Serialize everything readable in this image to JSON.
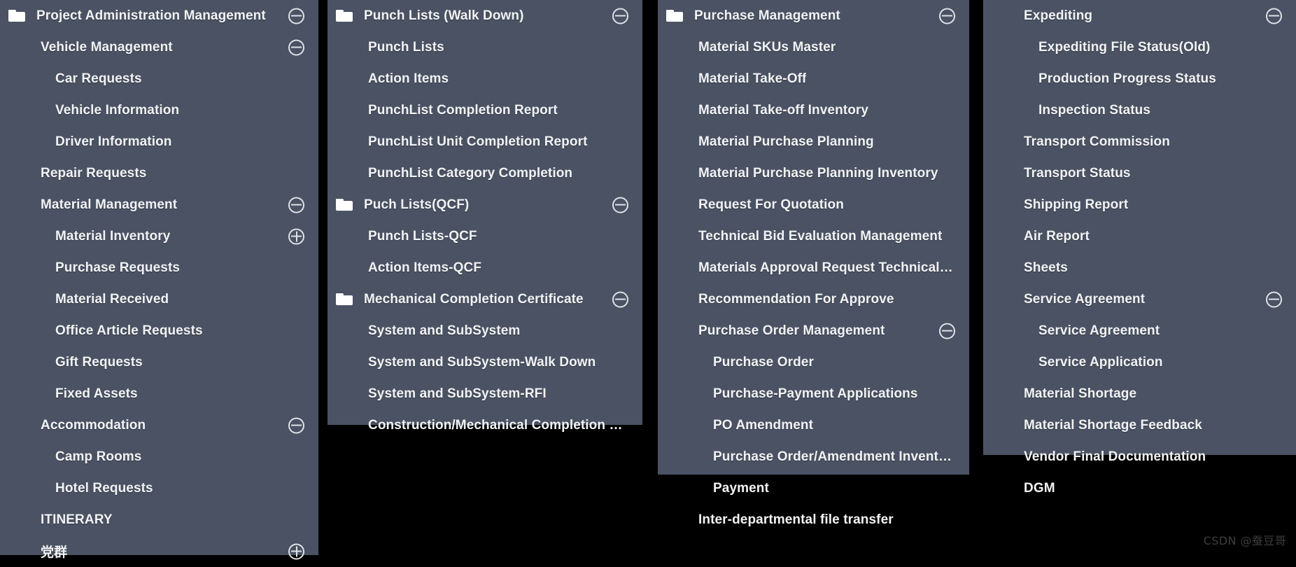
{
  "theme": {
    "page_background": "#000000",
    "panel_background": "#4a5263",
    "text_color": "#f2f3f5",
    "icon_color": "#dfe2e8",
    "watermark_color": "#3e3e3e"
  },
  "watermark": "CSDN @蚕豆哥",
  "columns": [
    {
      "id": "col-1",
      "items": [
        {
          "label": "Project Administration Management",
          "level": 0,
          "folder": true,
          "toggle": "minus"
        },
        {
          "label": "Vehicle Management",
          "level": 1,
          "folder": false,
          "toggle": "minus"
        },
        {
          "label": "Car Requests",
          "level": 2,
          "folder": false,
          "toggle": null
        },
        {
          "label": "Vehicle Information",
          "level": 2,
          "folder": false,
          "toggle": null
        },
        {
          "label": "Driver Information",
          "level": 2,
          "folder": false,
          "toggle": null
        },
        {
          "label": "Repair Requests",
          "level": 1,
          "folder": false,
          "toggle": null
        },
        {
          "label": "Material Management",
          "level": 1,
          "folder": false,
          "toggle": "minus"
        },
        {
          "label": "Material Inventory",
          "level": 2,
          "folder": false,
          "toggle": "plus"
        },
        {
          "label": "Purchase Requests",
          "level": 2,
          "folder": false,
          "toggle": null
        },
        {
          "label": "Material Received",
          "level": 2,
          "folder": false,
          "toggle": null
        },
        {
          "label": "Office Article Requests",
          "level": 2,
          "folder": false,
          "toggle": null
        },
        {
          "label": "Gift Requests",
          "level": 2,
          "folder": false,
          "toggle": null
        },
        {
          "label": "Fixed Assets",
          "level": 2,
          "folder": false,
          "toggle": null
        },
        {
          "label": "Accommodation",
          "level": 1,
          "folder": false,
          "toggle": "minus"
        },
        {
          "label": "Camp Rooms",
          "level": 2,
          "folder": false,
          "toggle": null
        },
        {
          "label": "Hotel Requests",
          "level": 2,
          "folder": false,
          "toggle": null
        },
        {
          "label": "ITINERARY",
          "level": 1,
          "folder": false,
          "toggle": null
        },
        {
          "label": "党群",
          "level": 1,
          "folder": false,
          "toggle": "plus"
        }
      ]
    },
    {
      "id": "col-2",
      "items": [
        {
          "label": "Punch Lists (Walk Down)",
          "level": 0,
          "folder": true,
          "toggle": "minus"
        },
        {
          "label": "Punch Lists",
          "level": 1,
          "folder": false,
          "toggle": null
        },
        {
          "label": "Action Items",
          "level": 1,
          "folder": false,
          "toggle": null
        },
        {
          "label": "PunchList Completion Report",
          "level": 1,
          "folder": false,
          "toggle": null
        },
        {
          "label": "PunchList Unit Completion Report",
          "level": 1,
          "folder": false,
          "toggle": null
        },
        {
          "label": "PunchList Category Completion",
          "level": 1,
          "folder": false,
          "toggle": null
        },
        {
          "label": "Puch Lists(QCF)",
          "level": 0,
          "folder": true,
          "toggle": "minus"
        },
        {
          "label": "Punch Lists-QCF",
          "level": 1,
          "folder": false,
          "toggle": null
        },
        {
          "label": "Action Items-QCF",
          "level": 1,
          "folder": false,
          "toggle": null
        },
        {
          "label": "Mechanical Completion Certificate",
          "level": 0,
          "folder": true,
          "toggle": "minus"
        },
        {
          "label": "System and SubSystem",
          "level": 1,
          "folder": false,
          "toggle": null
        },
        {
          "label": "System and SubSystem-Walk Down",
          "level": 1,
          "folder": false,
          "toggle": null
        },
        {
          "label": "System and SubSystem-RFI",
          "level": 1,
          "folder": false,
          "toggle": null
        },
        {
          "label": "Construction/Mechanical Completion Cer…",
          "level": 1,
          "folder": false,
          "toggle": null
        }
      ]
    },
    {
      "id": "col-3",
      "items": [
        {
          "label": "Purchase Management",
          "level": 0,
          "folder": true,
          "toggle": "minus"
        },
        {
          "label": "Material SKUs Master",
          "level": 1,
          "folder": false,
          "toggle": null
        },
        {
          "label": "Material Take-Off",
          "level": 1,
          "folder": false,
          "toggle": null
        },
        {
          "label": "Material Take-off Inventory",
          "level": 1,
          "folder": false,
          "toggle": null
        },
        {
          "label": "Material Purchase Planning",
          "level": 1,
          "folder": false,
          "toggle": null
        },
        {
          "label": "Material Purchase Planning Inventory",
          "level": 1,
          "folder": false,
          "toggle": null
        },
        {
          "label": "Request For Quotation",
          "level": 1,
          "folder": false,
          "toggle": null
        },
        {
          "label": "Technical Bid Evaluation Management",
          "level": 1,
          "folder": false,
          "toggle": null
        },
        {
          "label": "Materials Approval Request Technical Part",
          "level": 1,
          "folder": false,
          "toggle": null
        },
        {
          "label": "Recommendation For Approve",
          "level": 1,
          "folder": false,
          "toggle": null
        },
        {
          "label": "Purchase Order Management",
          "level": 1,
          "folder": false,
          "toggle": "minus"
        },
        {
          "label": "Purchase Order",
          "level": 2,
          "folder": false,
          "toggle": null
        },
        {
          "label": "Purchase-Payment Applications",
          "level": 2,
          "folder": false,
          "toggle": null
        },
        {
          "label": "PO Amendment",
          "level": 2,
          "folder": false,
          "toggle": null
        },
        {
          "label": "Purchase Order/Amendment Inventory",
          "level": 2,
          "folder": false,
          "toggle": null
        },
        {
          "label": "Payment",
          "level": 2,
          "folder": false,
          "toggle": null
        },
        {
          "label": "Inter-departmental file transfer",
          "level": 1,
          "folder": false,
          "toggle": null
        }
      ]
    },
    {
      "id": "col-4",
      "items": [
        {
          "label": "Expediting",
          "level": 1,
          "folder": false,
          "toggle": "minus"
        },
        {
          "label": "Expediting File Status(Old)",
          "level": 2,
          "folder": false,
          "toggle": null
        },
        {
          "label": "Production Progress Status",
          "level": 2,
          "folder": false,
          "toggle": null
        },
        {
          "label": "Inspection Status",
          "level": 2,
          "folder": false,
          "toggle": null
        },
        {
          "label": "Transport Commission",
          "level": 1,
          "folder": false,
          "toggle": null
        },
        {
          "label": "Transport Status",
          "level": 1,
          "folder": false,
          "toggle": null
        },
        {
          "label": "Shipping Report",
          "level": 1,
          "folder": false,
          "toggle": null
        },
        {
          "label": "Air Report",
          "level": 1,
          "folder": false,
          "toggle": null
        },
        {
          "label": "Sheets",
          "level": 1,
          "folder": false,
          "toggle": null
        },
        {
          "label": "Service Agreement",
          "level": 1,
          "folder": false,
          "toggle": "minus"
        },
        {
          "label": "Service Agreement",
          "level": 2,
          "folder": false,
          "toggle": null
        },
        {
          "label": "Service Application",
          "level": 2,
          "folder": false,
          "toggle": null
        },
        {
          "label": "Material Shortage",
          "level": 1,
          "folder": false,
          "toggle": null
        },
        {
          "label": "Material Shortage Feedback",
          "level": 1,
          "folder": false,
          "toggle": null
        },
        {
          "label": "Vendor Final Documentation",
          "level": 1,
          "folder": false,
          "toggle": null
        },
        {
          "label": "DGM",
          "level": 1,
          "folder": false,
          "toggle": null
        }
      ]
    }
  ]
}
